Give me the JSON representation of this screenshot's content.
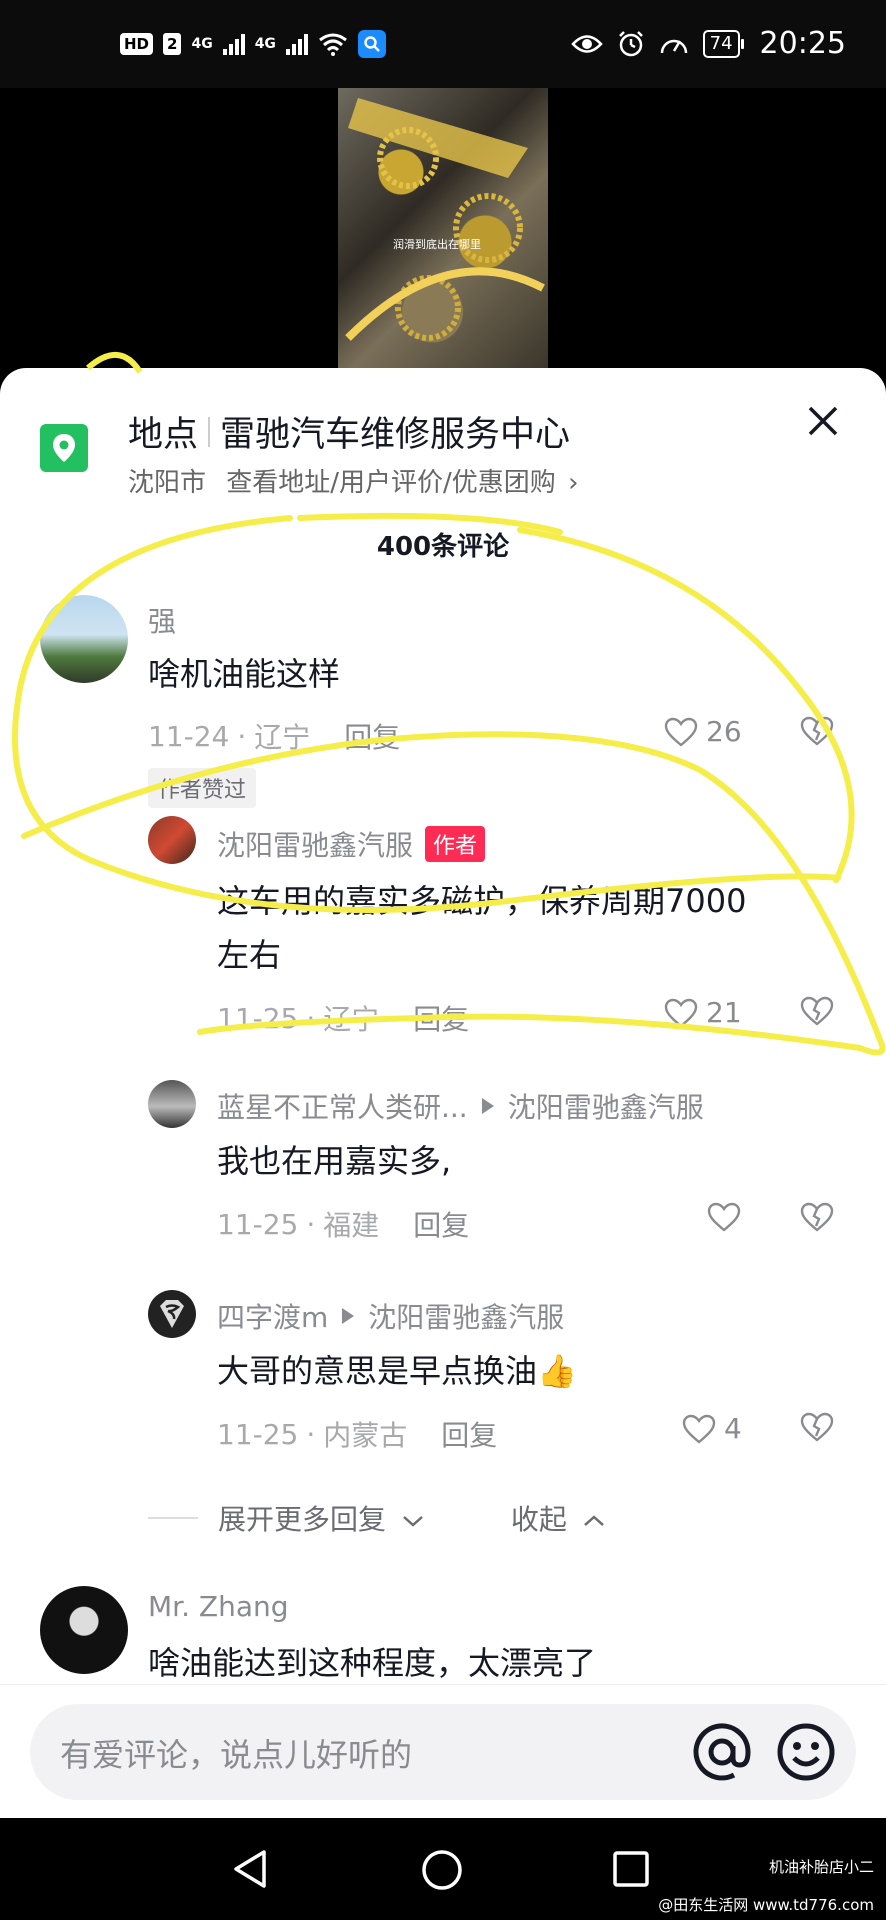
{
  "status_bar": {
    "hd": "HD",
    "sim": "2",
    "network_1": "4G",
    "network_2": "4G",
    "battery": "74",
    "time": "20:25"
  },
  "video": {
    "caption": "润滑到底出在哪里"
  },
  "location": {
    "label": "地点",
    "name": "雷驰汽车维修服务中心",
    "city": "沈阳市",
    "links": "查看地址/用户评价/优惠团购",
    "chevron": "›"
  },
  "comment_count": "400条评论",
  "comments": [
    {
      "user": "强",
      "text": "啥机油能这样",
      "date": "11-24",
      "region": "辽宁",
      "reply_label": "回复",
      "likes": "26",
      "badge": "作者赞过"
    },
    {
      "user": "沈阳雷驰鑫汽服",
      "author_tag": "作者",
      "text_line1": "这车用的嘉实多磁护，保养周期7000",
      "text_line2": "左右",
      "date": "11-25",
      "region": "辽宁",
      "reply_label": "回复",
      "likes": "21"
    },
    {
      "user": "蓝星不正常人类研...",
      "reply_to": "沈阳雷驰鑫汽服",
      "text": "我也在用嘉实多,",
      "date": "11-25",
      "region": "福建",
      "reply_label": "回复",
      "likes": ""
    },
    {
      "user": "四字渡m",
      "reply_to": "沈阳雷驰鑫汽服",
      "text": "大哥的意思是早点换油👍",
      "date": "11-25",
      "region": "内蒙古",
      "reply_label": "回复",
      "likes": "4"
    },
    {
      "user": "Mr.  Zhang",
      "text": "啥油能达到这种程度，太漂亮了"
    }
  ],
  "expand": {
    "more": "展开更多回复",
    "collapse": "收起"
  },
  "input": {
    "placeholder": "有爱评论，说点儿好听的"
  },
  "watermark": {
    "line1": "机油补胎店小二",
    "line2": "@田东生活网 www.td776.com"
  },
  "colors": {
    "location_green": "#22c061",
    "author_red": "#fe2c55",
    "annotation_yellow": "#f5ee4a"
  },
  "icons": [
    "location-pin-icon",
    "close-icon",
    "heart-icon",
    "dislike-heart-icon",
    "at-icon",
    "smile-icon",
    "back-icon",
    "home-icon",
    "recents-icon"
  ]
}
